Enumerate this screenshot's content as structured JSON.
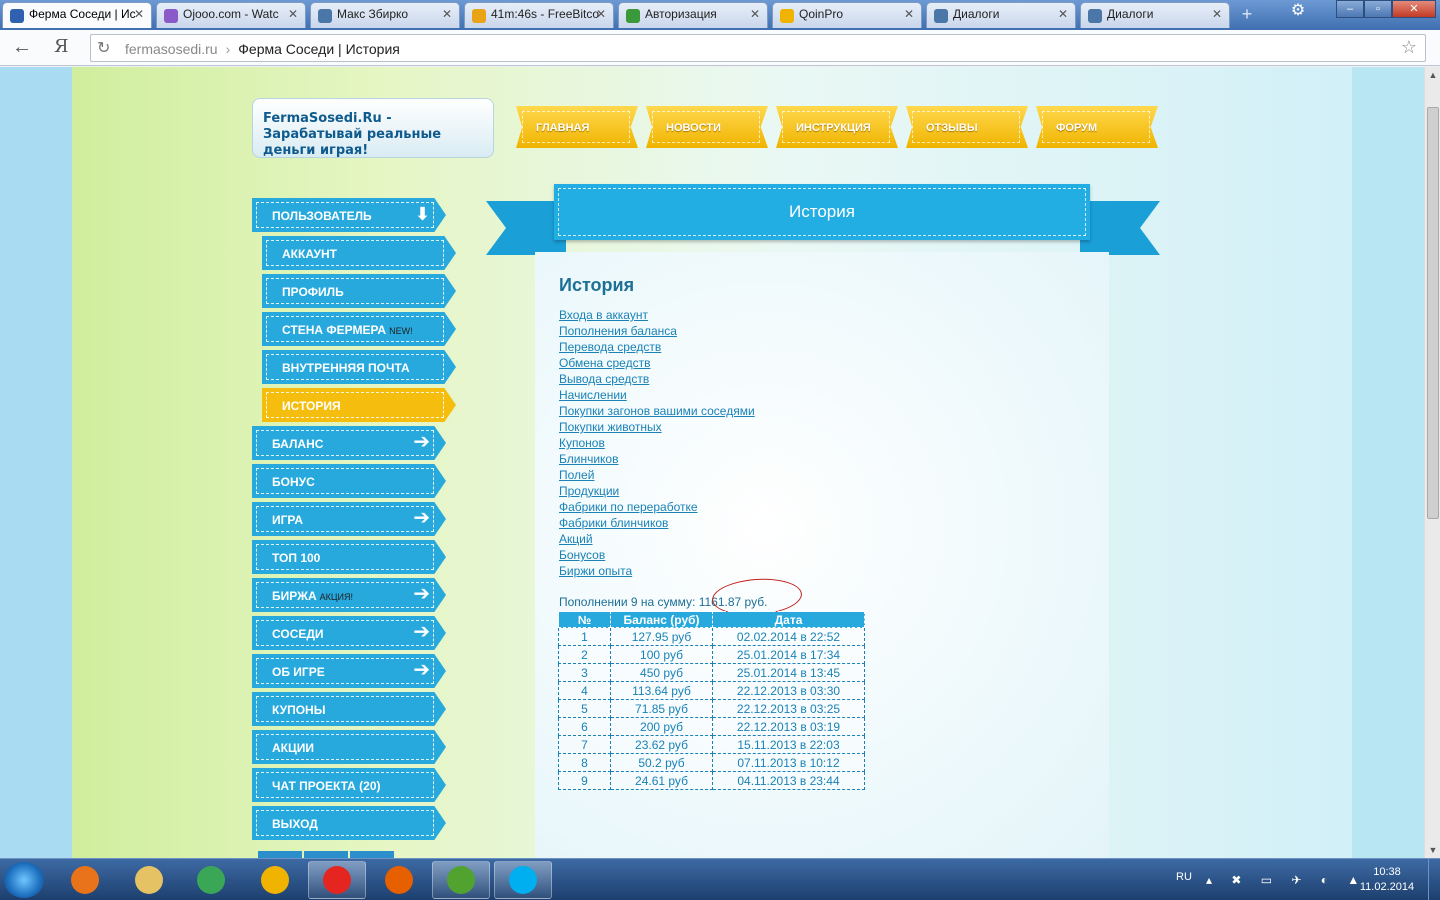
{
  "browser": {
    "tabs": [
      {
        "title": "Ферма Соседи | Ис",
        "fav_color": "#3060b0",
        "active": true
      },
      {
        "title": "Ojooo.com - Watc",
        "fav_color": "#8a5ac8"
      },
      {
        "title": "Макс Збирко",
        "fav_color": "#4a76a8"
      },
      {
        "title": "41m:46s - FreeBitco",
        "fav_color": "#e8a317"
      },
      {
        "title": "Авторизация",
        "fav_color": "#3a9a3a"
      },
      {
        "title": "QoinPro",
        "fav_color": "#f0b400"
      },
      {
        "title": "Диалоги",
        "fav_color": "#4a76a8"
      },
      {
        "title": "Диалоги",
        "fav_color": "#4a76a8"
      }
    ],
    "address": {
      "domain": "fermasosedi.ru",
      "separator": "›",
      "page_title": "Ферма Соседи | История"
    }
  },
  "site": {
    "logo_text": "FermaSosedi.Ru - Зарабатывай реальные деньги играя!",
    "top_nav": [
      "ГЛАВНАЯ",
      "НОВОСТИ",
      "ИНСТРУКЦИЯ",
      "ОТЗЫВЫ",
      "ФОРУМ"
    ],
    "left_menu": [
      {
        "label": "ПОЛЬЗОВАТЕЛЬ",
        "tag": "",
        "icon": "arrow-down-icon",
        "sub": false,
        "active": false
      },
      {
        "label": "АККАУНТ",
        "tag": "",
        "icon": "",
        "sub": true,
        "active": false
      },
      {
        "label": "ПРОФИЛЬ",
        "tag": "",
        "icon": "",
        "sub": true,
        "active": false
      },
      {
        "label": "СТЕНА ФЕРМЕРА",
        "tag": "NEW!",
        "icon": "",
        "sub": true,
        "active": false
      },
      {
        "label": "ВНУТРЕННЯЯ ПОЧТА",
        "tag": "",
        "icon": "",
        "sub": true,
        "active": false
      },
      {
        "label": "ИСТОРИЯ",
        "tag": "",
        "icon": "",
        "sub": true,
        "active": true
      },
      {
        "label": "БАЛАНС",
        "tag": "",
        "icon": "arrow-right-icon",
        "sub": false,
        "active": false
      },
      {
        "label": "БОНУС",
        "tag": "",
        "icon": "",
        "sub": false,
        "active": false
      },
      {
        "label": "ИГРА",
        "tag": "",
        "icon": "arrow-right-icon",
        "sub": false,
        "active": false
      },
      {
        "label": "ТОП 100",
        "tag": "",
        "icon": "",
        "sub": false,
        "active": false
      },
      {
        "label": "БИРЖА",
        "tag": "АКЦИЯ!",
        "icon": "arrow-right-icon",
        "sub": false,
        "active": false
      },
      {
        "label": "СОСЕДИ",
        "tag": "",
        "icon": "arrow-right-icon",
        "sub": false,
        "active": false
      },
      {
        "label": "ОБ ИГРЕ",
        "tag": "",
        "icon": "arrow-right-icon",
        "sub": false,
        "active": false
      },
      {
        "label": "КУПОНЫ",
        "tag": "",
        "icon": "",
        "sub": false,
        "active": false
      },
      {
        "label": "АКЦИИ",
        "tag": "",
        "icon": "",
        "sub": false,
        "active": false
      },
      {
        "label": "ЧАТ ПРОЕКТА (20)",
        "tag": "",
        "icon": "",
        "sub": false,
        "active": false
      },
      {
        "label": "ВЫХОД",
        "tag": "",
        "icon": "",
        "sub": false,
        "active": false
      }
    ]
  },
  "content": {
    "banner_title": "История",
    "heading": "История",
    "links": [
      "Входа в аккаунт",
      "Пополнения баланса",
      "Перевода средств",
      "Обмена средств",
      "Вывода средств",
      "Начислении",
      "Покупки загонов вашими соседями",
      "Покупки животных",
      "Купонов",
      "Блинчиков",
      "Полей",
      "Продукции",
      "Фабрики по переработке",
      "Фабрики блинчиков",
      "Акций",
      "Бонусов",
      "Биржи опыта"
    ],
    "summary_prefix": "Пополнении 9 на сумму:",
    "summary_amount": "1161.87 руб.",
    "table": {
      "headers": [
        "№",
        "Баланс (руб)",
        "Дата"
      ],
      "rows": [
        [
          "1",
          "127.95 руб",
          "02.02.2014 в 22:52"
        ],
        [
          "2",
          "100 руб",
          "25.01.2014 в 17:34"
        ],
        [
          "3",
          "450 руб",
          "25.01.2014 в 13:45"
        ],
        [
          "4",
          "113.64 руб",
          "22.12.2013 в 03:30"
        ],
        [
          "5",
          "71.85 руб",
          "22.12.2013 в 03:25"
        ],
        [
          "6",
          "200 руб",
          "22.12.2013 в 03:19"
        ],
        [
          "7",
          "23.62 руб",
          "15.11.2013 в 22:03"
        ],
        [
          "8",
          "50.2 руб",
          "07.11.2013 в 10:12"
        ],
        [
          "9",
          "24.61 руб",
          "04.11.2013 в 23:44"
        ]
      ]
    }
  },
  "taskbar": {
    "apps": [
      {
        "name": "media-player",
        "color": "#e8731a",
        "open": false
      },
      {
        "name": "file-explorer",
        "color": "#e5c263",
        "open": false
      },
      {
        "name": "chrome",
        "color": "#3aa757",
        "open": false
      },
      {
        "name": "mail-agent",
        "color": "#f0b400",
        "open": false
      },
      {
        "name": "yandex-browser",
        "color": "#e52620",
        "open": true
      },
      {
        "name": "firefox",
        "color": "#e66000",
        "open": false
      },
      {
        "name": "utorrent",
        "color": "#4fa32e",
        "open": true
      },
      {
        "name": "skype",
        "color": "#00aff0",
        "open": true
      }
    ],
    "language": "RU",
    "time": "10:38",
    "date": "11.02.2014"
  }
}
